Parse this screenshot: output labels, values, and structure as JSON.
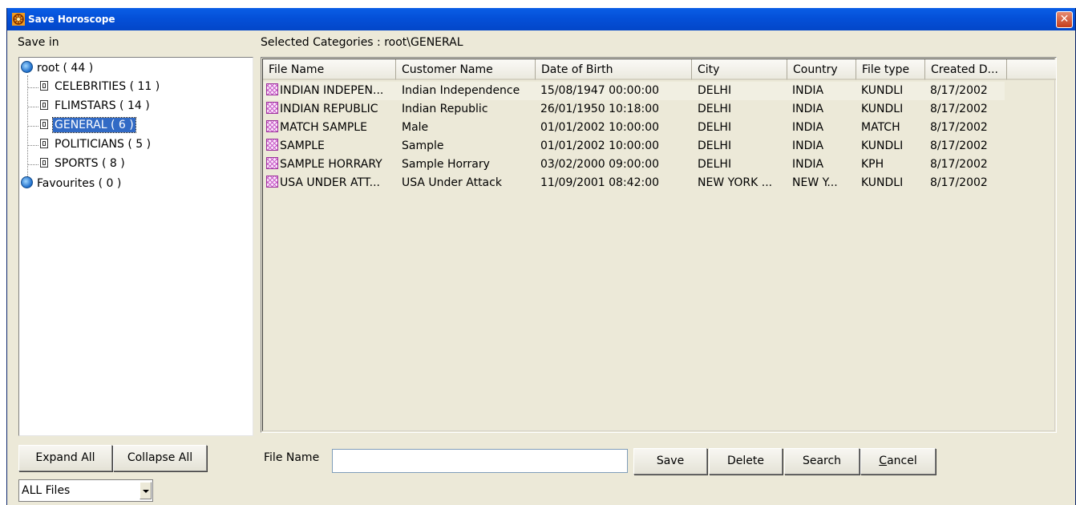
{
  "window": {
    "title": "Save Horoscope"
  },
  "left": {
    "save_in_label": "Save in",
    "tree": [
      {
        "label": "root ( 44 )",
        "type": "root"
      },
      {
        "label": "CELEBRITIES ( 11 )",
        "type": "child"
      },
      {
        "label": "FLIMSTARS ( 14 )",
        "type": "child"
      },
      {
        "label": "GENERAL ( 6 )",
        "type": "child",
        "selected": true
      },
      {
        "label": "POLITICIANS ( 5 )",
        "type": "child"
      },
      {
        "label": "SPORTS ( 8 )",
        "type": "child"
      },
      {
        "label": "Favourites ( 0 )",
        "type": "root"
      }
    ],
    "expand_all": "Expand All",
    "collapse_all": "Collapse All",
    "filter_select": {
      "value": "ALL Files"
    }
  },
  "right": {
    "selected_categories": "Selected Categories : root\\GENERAL",
    "columns": [
      "File Name",
      "Customer Name",
      "Date of Birth",
      "City",
      "Country",
      "File type",
      "Created D..."
    ],
    "rows": [
      [
        "INDIAN INDEPEN...",
        "Indian Independence",
        "15/08/1947 00:00:00",
        "DELHI",
        "INDIA",
        "KUNDLI",
        "8/17/2002"
      ],
      [
        "INDIAN REPUBLIC",
        "Indian Republic",
        "26/01/1950 10:18:00",
        "DELHI",
        "INDIA",
        "KUNDLI",
        "8/17/2002"
      ],
      [
        "MATCH SAMPLE",
        "Male",
        "01/01/2002 10:00:00",
        "DELHI",
        "INDIA",
        "MATCH",
        "8/17/2002"
      ],
      [
        "SAMPLE",
        "Sample",
        "01/01/2002 10:00:00",
        "DELHI",
        "INDIA",
        "KUNDLI",
        "8/17/2002"
      ],
      [
        "SAMPLE HORRARY",
        "Sample Horrary",
        "03/02/2000 09:00:00",
        "DELHI",
        "INDIA",
        "KPH",
        "8/17/2002"
      ],
      [
        "USA UNDER ATT...",
        "USA Under Attack",
        "11/09/2001 08:42:00",
        "NEW YORK ...",
        "NEW Y...",
        "KUNDLI",
        "8/17/2002"
      ]
    ],
    "file_name_label": "File Name",
    "file_name_value": "",
    "buttons": {
      "save": "Save",
      "delete": "Delete",
      "search": "Search",
      "cancel_first": "C",
      "cancel_rest": "ancel"
    }
  },
  "colors": {
    "titlebar": "#0450d8",
    "selection": "#316ac5",
    "dialog_bg": "#ece9d8",
    "hover_row": "#f1efe2"
  }
}
